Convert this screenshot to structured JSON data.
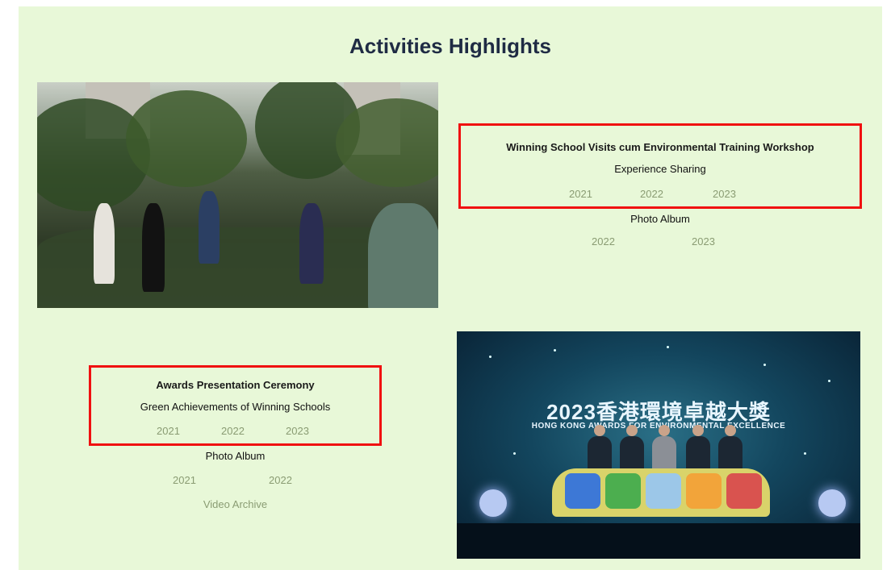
{
  "page": {
    "title": "Activities Highlights"
  },
  "photo_top": {
    "alt": "Group touring a garden"
  },
  "photo_bottom": {
    "headline_cn": "2023香港環境卓越大獎",
    "headline_en": "HONG KONG AWARDS FOR ENVIRONMENTAL EXCELLENCE"
  },
  "section_visits": {
    "heading": "Winning School Visits cum Environmental Training Workshop",
    "subheading": "Experience Sharing",
    "sharing_years": [
      "2021",
      "2022",
      "2023"
    ],
    "album_label": "Photo Album",
    "album_years": [
      "2022",
      "2023"
    ]
  },
  "section_awards": {
    "heading": "Awards Presentation Ceremony",
    "subheading": "Green Achievements of Winning Schools",
    "achievement_years": [
      "2021",
      "2022",
      "2023"
    ],
    "album_label": "Photo Album",
    "album_years": [
      "2021",
      "2022"
    ],
    "video_label": "Video Archive"
  },
  "colors": {
    "panel_bg": "#e8f8d8",
    "highlight_border": "#f01010",
    "link": "#8a9c73",
    "title": "#1f2b44"
  }
}
